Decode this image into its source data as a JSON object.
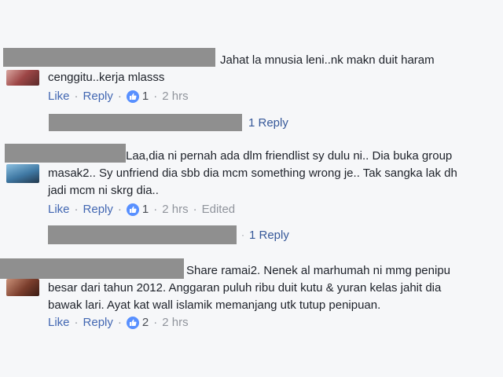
{
  "comments": [
    {
      "line1": "Jahat la mnusia leni..nk makn duit haram",
      "line2": "cenggitu..kerja mlasss",
      "actions": {
        "like": "Like",
        "reply": "Reply",
        "count": "1",
        "time": "2 hrs",
        "edited": ""
      },
      "replies_link": "1 Reply",
      "avatar_colors": [
        "#c98a8a",
        "#8f3b3b"
      ]
    },
    {
      "line1": "Laa,dia ni pernah ada dlm friendlist sy dulu ni.. Dia buka group",
      "line2": "masak2.. Sy unfriend dia sbb dia mcm something wrong je.. Tak sangka lak dh",
      "line3": "jadi mcm ni skrg dia..",
      "actions": {
        "like": "Like",
        "reply": "Reply",
        "count": "1",
        "time": "2 hrs",
        "edited": "Edited"
      },
      "replies_link": "1 Reply",
      "avatar_colors": [
        "#6fa3c7",
        "#2c4a64"
      ]
    },
    {
      "line1": "Share ramai2. Nenek al marhumah ni mmg penipu",
      "line2": "besar dari tahun 2012. Anggaran puluh ribu duit kutu & yuran kelas jahit dia",
      "line3": "bawak lari. Ayat kat wall islamik memanjang utk tutup penipuan.",
      "actions": {
        "like": "Like",
        "reply": "Reply",
        "count": "2",
        "time": "2 hrs",
        "edited": ""
      },
      "avatar_colors": [
        "#a46a55",
        "#4d2a20"
      ]
    }
  ],
  "colors": {
    "link": "#4267b2",
    "meta": "#90949c",
    "like_badge": "#5890ff",
    "redaction": "#8f8f8f",
    "background": "#f6f7f9"
  },
  "icons": {
    "like": "thumbs-up-icon",
    "reply_arrow": "reply-arrow-icon"
  }
}
